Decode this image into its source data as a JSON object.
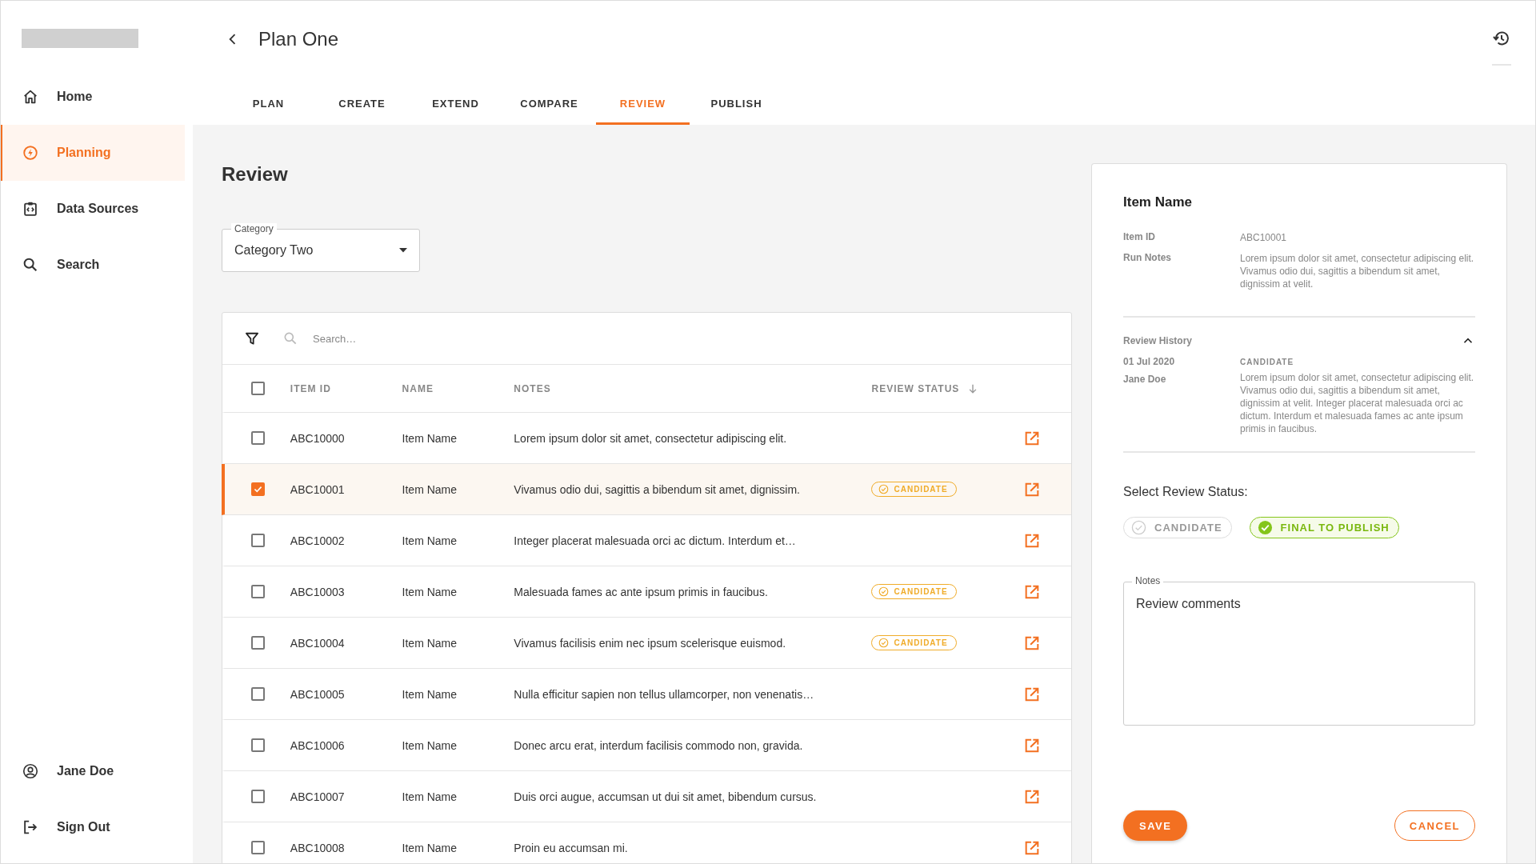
{
  "sidebar": {
    "items": [
      {
        "label": "Home",
        "kind": "home",
        "selected": false
      },
      {
        "label": "Planning",
        "kind": "planning",
        "selected": true
      },
      {
        "label": "Data Sources",
        "kind": "data-sources",
        "selected": false
      },
      {
        "label": "Search",
        "kind": "search",
        "selected": false
      }
    ],
    "footer_items": [
      {
        "label": "Jane Doe",
        "kind": "user"
      },
      {
        "label": "Sign Out",
        "kind": "sign-out"
      }
    ]
  },
  "header": {
    "title": "Plan One"
  },
  "tabs": [
    {
      "label": "PLAN",
      "selected": false
    },
    {
      "label": "CREATE",
      "selected": false
    },
    {
      "label": "EXTEND",
      "selected": false
    },
    {
      "label": "COMPARE",
      "selected": false
    },
    {
      "label": "REVIEW",
      "selected": true
    },
    {
      "label": "PUBLISH",
      "selected": false
    }
  ],
  "page_title": "Review",
  "category": {
    "label": "Category",
    "value": "Category Two"
  },
  "table": {
    "search": {
      "placeholder": "Search…"
    },
    "select_all": {
      "checked": false
    },
    "columns": [
      {
        "label": "ITEM ID",
        "sorted": false
      },
      {
        "label": "NAME",
        "sorted": false
      },
      {
        "label": "NOTES",
        "sorted": false
      },
      {
        "label": "REVIEW STATUS",
        "sorted": true
      }
    ],
    "rows": [
      {
        "item_id": "ABC10000",
        "name": "Item Name",
        "notes": "Lorem ipsum dolor sit amet, consectetur adipiscing elit.",
        "selected": false
      },
      {
        "item_id": "ABC10001",
        "name": "Item Name",
        "notes": "Vivamus odio dui, sagittis a bibendum sit amet, dignissim.",
        "review_status": "CANDIDATE",
        "selected": true
      },
      {
        "item_id": "ABC10002",
        "name": "Item Name",
        "notes": "Integer placerat malesuada orci ac dictum. Interdum et…",
        "selected": false
      },
      {
        "item_id": "ABC10003",
        "name": "Item Name",
        "notes": "Malesuada fames ac ante ipsum primis in faucibus.",
        "review_status": "CANDIDATE",
        "selected": false
      },
      {
        "item_id": "ABC10004",
        "name": "Item Name",
        "notes": "Vivamus facilisis enim nec ipsum scelerisque euismod.",
        "review_status": "CANDIDATE",
        "selected": false
      },
      {
        "item_id": "ABC10005",
        "name": "Item Name",
        "notes": "Nulla efficitur sapien non tellus ullamcorper, non venenatis…",
        "selected": false
      },
      {
        "item_id": "ABC10006",
        "name": "Item Name",
        "notes": "Donec arcu erat, interdum facilisis commodo non, gravida.",
        "selected": false
      },
      {
        "item_id": "ABC10007",
        "name": "Item Name",
        "notes": "Duis orci augue, accumsan ut dui sit amet, bibendum cursus.",
        "selected": false
      },
      {
        "item_id": "ABC10008",
        "name": "Item Name",
        "notes": "Proin eu accumsan mi.",
        "selected": false
      }
    ]
  },
  "detail": {
    "title": "Item Name",
    "fields": [
      {
        "label": "Item ID",
        "value": "ABC10001"
      },
      {
        "label": "Run Notes",
        "value": "Lorem ipsum dolor sit amet, consectetur adipiscing elit. Vivamus odio dui, sagittis a bibendum sit amet, dignissim at velit."
      }
    ],
    "history": {
      "title": "Review History",
      "expanded": true,
      "entries": [
        {
          "date": "01 Jul 2020",
          "author": "Jane Doe",
          "status": "CANDIDATE",
          "comment": "Lorem ipsum dolor sit amet, consectetur adipiscing elit. Vivamus odio dui, sagittis a bibendum sit amet, dignissim at velit. Integer placerat malesuada orci ac dictum. Interdum et malesuada fames ac ante ipsum primis in faucibus."
        }
      ]
    },
    "status_prompt": "Select Review Status:",
    "status_options": [
      {
        "label": "CANDIDATE",
        "selected": false
      },
      {
        "label": "FINAL TO PUBLISH",
        "selected": true
      }
    ],
    "notes": {
      "label": "Notes",
      "value": "Review comments"
    },
    "buttons": [
      {
        "label": "SAVE",
        "kind": "primary"
      },
      {
        "label": "CANCEL",
        "kind": "secondary"
      }
    ]
  }
}
